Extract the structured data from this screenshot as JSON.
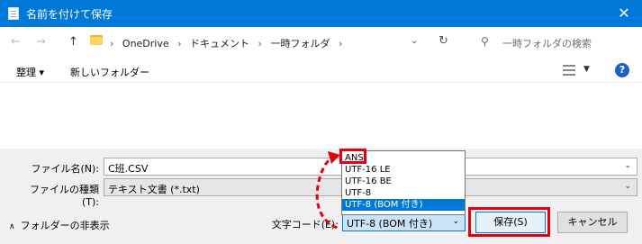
{
  "titlebar": {
    "title": "名前を付けて保存",
    "close_icon": "close-icon"
  },
  "nav": {
    "back": "←",
    "forward": "→",
    "up": "↑",
    "breadcrumb": [
      "OneDrive",
      "ドキュメント",
      "一時フォルダ"
    ],
    "search_placeholder": "一時フォルダの検索"
  },
  "toolbar": {
    "organize": "整理 ▾",
    "new_folder": "新しいフォルダー"
  },
  "form": {
    "filename_label": "ファイル名(N):",
    "filename_value": "C班.CSV",
    "filetype_label": "ファイルの種類(T):",
    "filetype_value": "テキスト文書 (*.txt)",
    "hide_folders": "フォルダーの非表示",
    "encoding_label": "文字コード(E):",
    "encoding_value": "UTF-8 (BOM 付き)",
    "save_label": "保存(S)",
    "cancel_label": "キャンセル"
  },
  "encoding_options": [
    "ANSI",
    "UTF-16 LE",
    "UTF-16 BE",
    "UTF-8",
    "UTF-8 (BOM 付き)"
  ],
  "colors": {
    "titlebar": "#0078d7",
    "accent": "#0078d7",
    "highlight": "#e60012"
  }
}
